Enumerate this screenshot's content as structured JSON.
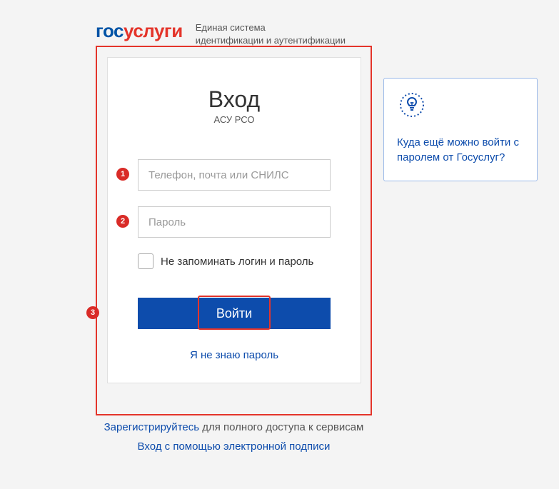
{
  "header": {
    "logo_part1": "гос",
    "logo_part2": "услуги",
    "tagline_line1": "Единая система",
    "tagline_line2": "идентификации и аутентификации"
  },
  "login": {
    "title": "Вход",
    "subtitle": "АСУ РСО",
    "login_placeholder": "Телефон, почта или СНИЛС",
    "password_placeholder": "Пароль",
    "remember_label": "Не запоминать логин и пароль",
    "submit_label": "Войти",
    "forgot_label": "Я не знаю пароль"
  },
  "markers": {
    "m1": "1",
    "m2": "2",
    "m3": "3"
  },
  "bottom": {
    "register_link": "Зарегистрируйтесь",
    "register_suffix": " для полного доступа к сервисам",
    "esign_link": "Вход с помощью электронной подписи"
  },
  "side": {
    "info_text": "Куда ещё можно войти с паролем от Госуслуг?"
  }
}
